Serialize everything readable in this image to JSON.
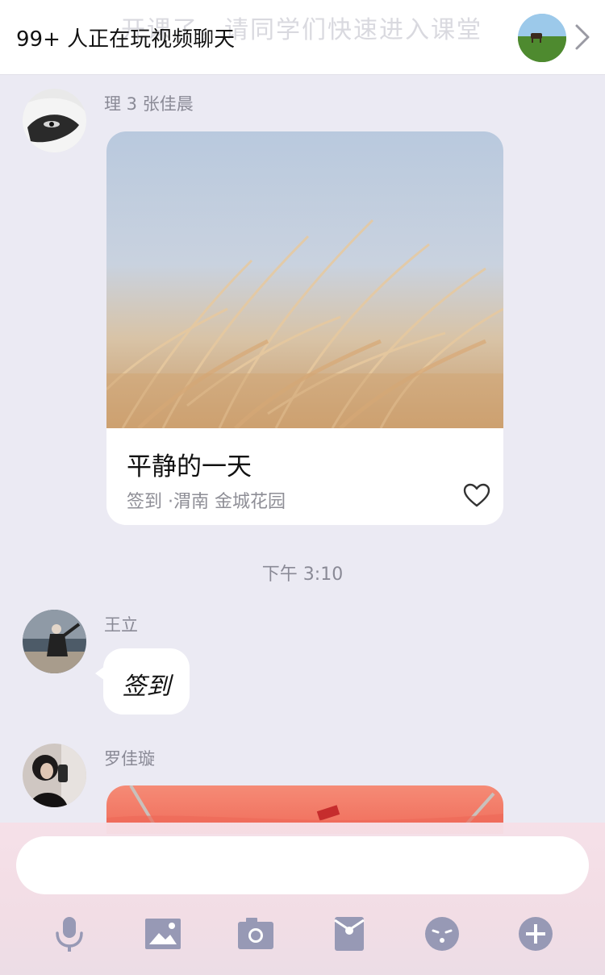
{
  "banner": {
    "ghost_text": "开课了，请同学们快速进入课堂",
    "title": "99+ 人正在玩视频聊天"
  },
  "messages": [
    {
      "sender": "理 3 张佳晨",
      "card": {
        "title": "平静的一天",
        "subtitle": "签到 ·渭南 金城花园"
      }
    },
    {
      "sender": "王立",
      "text": "签到"
    },
    {
      "sender": "罗佳璇"
    }
  ],
  "timestamp": "下午 3:10",
  "input": {
    "placeholder": ""
  },
  "toolbar": {
    "icons": [
      "microphone-icon",
      "image-icon",
      "camera-icon",
      "red-packet-icon",
      "emoji-icon",
      "plus-icon"
    ],
    "icon_color": "#9799b5"
  }
}
